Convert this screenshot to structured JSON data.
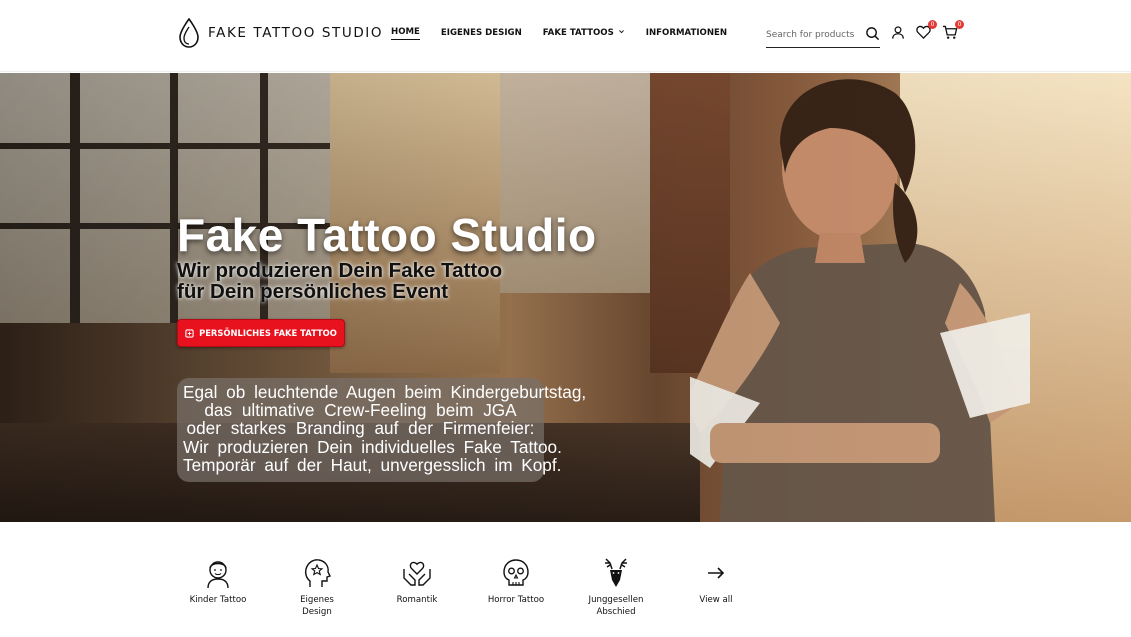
{
  "header": {
    "logo_text": "FAKE TATTOO STUDIO",
    "nav": [
      {
        "label": "HOME",
        "active": true
      },
      {
        "label": "EIGENES DESIGN"
      },
      {
        "label": "FAKE TATTOOS",
        "has_dropdown": true
      },
      {
        "label": "INFORMATIONEN"
      }
    ],
    "search_placeholder": "Search for products",
    "wishlist_count": "0",
    "cart_count": "0"
  },
  "hero": {
    "title": "Fake Tattoo Studio",
    "subtitle_line1": "Wir produzieren Dein Fake Tattoo",
    "subtitle_line2": "für Dein persönliches Event",
    "cta_label": "PERSÖNLICHES FAKE TATTOO",
    "text_lines": [
      "Egal ob leuchtende Augen beim Kindergeburtstag,",
      "das ultimative Crew-Feeling beim JGA",
      "oder starkes Branding auf der Firmenfeier:",
      "Wir produzieren Dein individuelles Fake Tattoo.",
      "Temporär auf der Haut, unvergesslich im Kopf."
    ]
  },
  "categories": [
    {
      "label": "Kinder Tattoo",
      "icon": "child-face-icon"
    },
    {
      "label": "Eigenes Design",
      "icon": "head-star-icon"
    },
    {
      "label": "Romantik",
      "icon": "hands-heart-icon"
    },
    {
      "label": "Horror Tattoo",
      "icon": "skull-icon"
    },
    {
      "label": "Junggesellen Abschied",
      "icon": "deer-antlers-icon"
    },
    {
      "label": "View all",
      "icon": "arrow-right-icon"
    }
  ],
  "colors": {
    "accent": "#e8111e",
    "badge": "#e53935",
    "text": "#111111"
  }
}
